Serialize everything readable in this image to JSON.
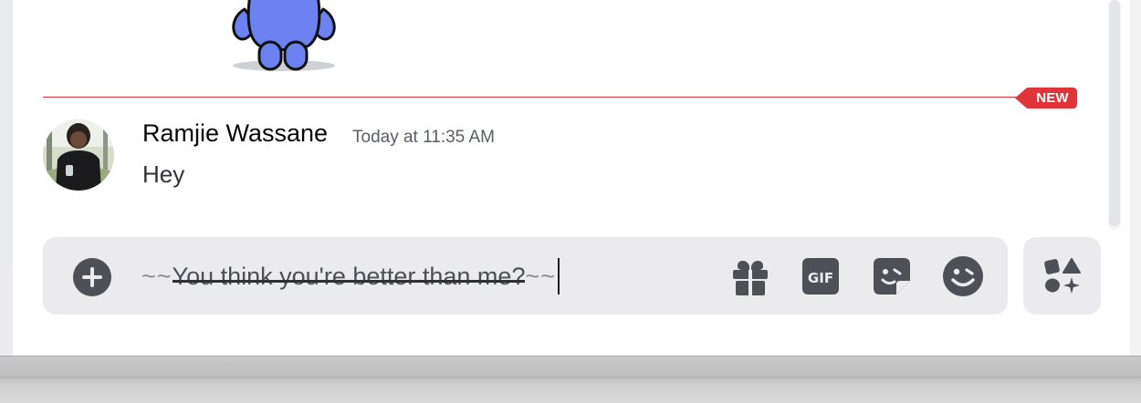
{
  "divider": {
    "badge": "NEW",
    "color": "#e0343a"
  },
  "message": {
    "author": "Ramjie Wassane",
    "timestamp": "Today at 11:35 AM",
    "text": "Hey"
  },
  "composer": {
    "markdown_prefix": "~~",
    "draft_text": "You think you're better than me?",
    "markdown_suffix": "~~"
  },
  "icons": {
    "upload": "plus-circle-icon",
    "gift": "gift-icon",
    "gif": "gif-icon",
    "sticker": "sticker-icon",
    "emoji": "emoji-icon",
    "apps": "apps-icon",
    "gif_label": "GIF"
  },
  "colors": {
    "accent_red": "#e0343a",
    "icon_gray": "#4e5058",
    "composer_bg": "#ebebed",
    "mascot_blue": "#6b82f0"
  }
}
